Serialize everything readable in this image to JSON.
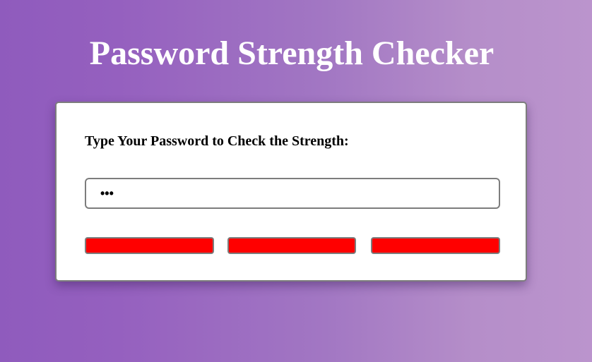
{
  "header": {
    "title": "Password Strength Checker"
  },
  "card": {
    "prompt": "Type Your Password to Check the Strength:",
    "password": {
      "value": "•••",
      "type": "password"
    },
    "strength_bars": [
      {
        "color": "#ff0000"
      },
      {
        "color": "#ff0000"
      },
      {
        "color": "#ff0000"
      }
    ]
  },
  "colors": {
    "background_left": "#8f5bbd",
    "background_right": "#bb94cd",
    "card_background": "#ffffff",
    "border": "#7d7d7d",
    "weak": "#ff0000"
  }
}
